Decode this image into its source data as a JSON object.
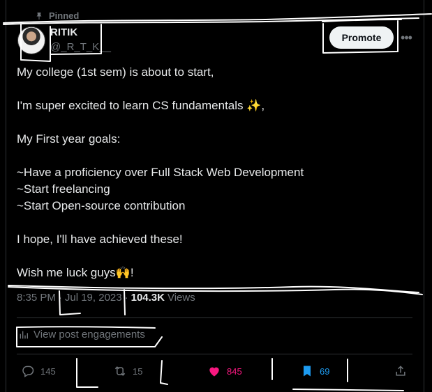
{
  "pinned_label": "Pinned",
  "author": {
    "display_name": "RITIK",
    "handle": "@_R_T_K__"
  },
  "promote_label": "Promote",
  "more_label": "•••",
  "body_lines": [
    "My college (1st sem) is about to start,",
    "",
    "I'm super excited to learn CS fundamentals ✨,",
    "",
    "My First year goals:",
    "",
    "~Have a proficiency over Full Stack Web Development",
    "~Start freelancing",
    "~Start Open-source contribution",
    "",
    "I hope, I'll have achieved these!",
    "",
    "Wish me luck guys🙌!"
  ],
  "meta": {
    "time": "8:35 PM",
    "sep1": "·",
    "date": "Jul 19, 2023",
    "sep2": "·",
    "views_count": "104.3K",
    "views_label": "Views"
  },
  "engagements_label": "View post engagements",
  "actions": {
    "replies": "145",
    "reposts": "15",
    "likes": "845",
    "bookmarks": "69"
  },
  "colors": {
    "like": "#f91880",
    "bookmark": "#1d9bf0",
    "muted": "#71767b",
    "text": "#e7e9ea"
  },
  "icons": [
    "pin-icon",
    "more-icon",
    "analytics-icon",
    "reply-icon",
    "repost-icon",
    "like-icon",
    "bookmark-icon",
    "share-icon"
  ]
}
